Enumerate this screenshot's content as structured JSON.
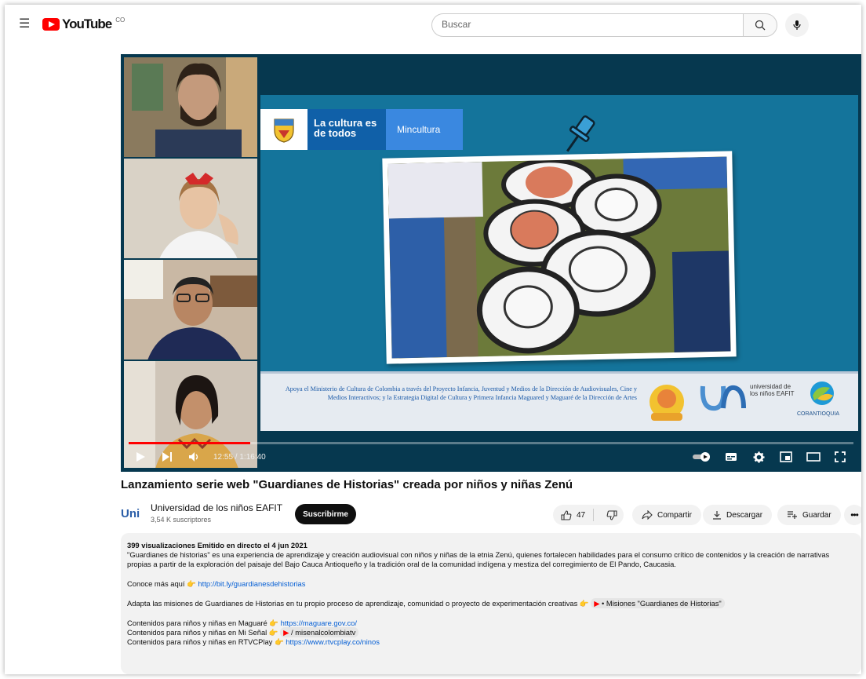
{
  "header": {
    "logo_text": "YouTube",
    "logo_sup": "CO",
    "search_placeholder": "Buscar"
  },
  "player": {
    "time": "12:55 / 1:16:40",
    "progress": 0.168,
    "slide": {
      "banner_main": "La cultura es de todos",
      "banner_ministry": "Mincultura",
      "credits": "Apoya el Ministerio de Cultura de Colombia a través del Proyecto Infancia, Juventud y Medios de la Dirección de Audiovisuales, Cine y Medios Interactivos; y la Estrategia Digital de Cultura y Primera Infancia Maguared y Maguaré de la Dirección de Artes",
      "logo_eafit": "universidad de los niños EAFIT",
      "logo_corantioquia": "CORANTIOQUIA"
    }
  },
  "video": {
    "title": "Lanzamiento serie web \"Guardianes de Historias\" creada por niños y niñas Zenú"
  },
  "channel": {
    "logo": "Uni",
    "name": "Universidad de los niños EAFIT",
    "subscribers": "3,54 K suscriptores",
    "subscribe_label": "Suscribirme"
  },
  "actions": {
    "likes": "47",
    "share": "Compartir",
    "download": "Descargar",
    "save": "Guardar"
  },
  "description": {
    "stats": "399 visualizaciones  Emitido en directo el 4 jun 2021",
    "paragraph": "\"Guardianes de historias\" es una experiencia de aprendizaje y creación audiovisual con niños y niñas de la etnia Zenú, quienes fortalecen habilidades para el consumo crítico de contenidos y la creación de narrativas propias a partir de la exploración del paisaje del Bajo Cauca Antioqueño y la tradición oral de la comunidad indígena y mestiza del corregimiento de El Pando, Caucasia.",
    "conoce_text": "Conoce más aquí",
    "conoce_link": "http://bit.ly/guardianesdehistorias",
    "adapta_text": "Adapta las misiones de Guardianes de Historias en tu propio proceso de aprendizaje, comunidad o proyecto de experimentación creativas",
    "adapta_chip": "• Misiones \"Guardianes de Historias\"",
    "maguare_text": "Contenidos para niños y niñas en Maguaré",
    "maguare_link": "https://maguare.gov.co/",
    "misenal_text": "Contenidos para niños y niñas en Mi Señal",
    "misenal_chip": "/ misenalcolombiatv",
    "rtvc_text": "Contenidos para niños y niñas en RTVCPlay",
    "rtvc_link": "https://www.rtvcplay.co/ninos"
  }
}
